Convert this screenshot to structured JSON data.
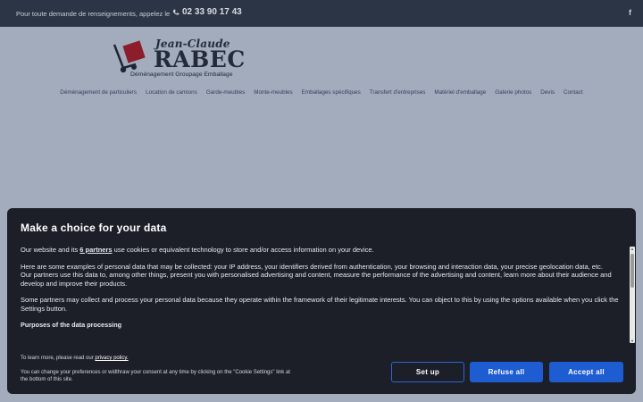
{
  "topbar": {
    "intro": "Pour toute demande de renseignements, appelez le",
    "phone": "02 33 90 17 43",
    "facebook": "f"
  },
  "logo": {
    "name_line1": "Jean-Claude",
    "name_line2": "RABEC",
    "tagline": "Déménagement Groupage Emballage"
  },
  "nav": {
    "items": [
      "Déménagement de particuliers",
      "Location de camions",
      "Garde-meubles",
      "Monte-meubles",
      "Emballages spécifiques",
      "Transfert d'entreprises",
      "Matériel d'emballage",
      "Galerie photos",
      "Devis",
      "Contact"
    ]
  },
  "cookie": {
    "title": "Make a choice for your data",
    "p1_prefix": "Our website and its ",
    "p1_link": "6 partners",
    "p1_suffix": " use cookies or equivalent technology to store and/or access information on your device.",
    "p2": "Here are some examples of personal data that may be collected: your IP address, your identifiers derived from authentication, your browsing and interaction data, your precise geolocation data, etc.",
    "p3": "Our partners use this data to, among other things, present you with personalised advertising and content, measure the performance of the advertising and content, learn more about their audience and develop and improve their products.",
    "p4": "Some partners may collect and process your personal data because they operate within the framework of their legitimate interests. You can object to this by using the options available when you click the Settings button.",
    "purposes_heading": "Purposes of the data processing",
    "learn_prefix": "To learn more, please read our ",
    "learn_link": "privacy policy.",
    "change_text": "You can change your preferences or widthraw your consent at any time by clicking on the \"Cookie Settings\" link at the bottom of this site.",
    "btn_setup": "Set up",
    "btn_refuse": "Refuse all",
    "btn_accept": "Accept all"
  },
  "colors": {
    "topbar_bg": "#2c3545",
    "page_bg": "#a2acbd",
    "dialog_bg": "#1c1f28",
    "button_blue": "#1e5cd2",
    "logo_red": "#8b1e2a"
  }
}
